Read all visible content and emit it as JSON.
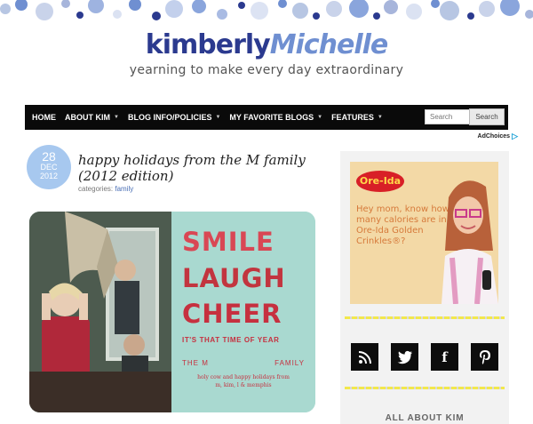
{
  "header": {
    "logo_first": "kimberly",
    "logo_last": "Michelle",
    "tagline": "yearning to make every day extraordinary"
  },
  "nav": {
    "items": [
      {
        "label": "HOME",
        "dropdown": false
      },
      {
        "label": "ABOUT KIM",
        "dropdown": true
      },
      {
        "label": "BLOG INFO/POLICIES",
        "dropdown": true
      },
      {
        "label": "MY FAVORITE BLOGS",
        "dropdown": true
      },
      {
        "label": "FEATURES",
        "dropdown": true
      }
    ],
    "search_placeholder": "Search",
    "search_button": "Search"
  },
  "adchoices": "AdChoices",
  "post": {
    "date_day": "28",
    "date_month": "DEC",
    "date_year": "2012",
    "title": "happy holidays from the M family (2012 edition)",
    "categories_label": "categories:",
    "category": "family",
    "card": {
      "word1": "SMILE",
      "word2": "LAUGH",
      "word3": "CHEER",
      "tagline": "IT'S THAT TIME OF YEAR",
      "family_left": "THE M",
      "family_right": "FAMILY",
      "message_line1": "holy cow and happy holidays from",
      "message_line2": "m, kim, l     & memphis"
    }
  },
  "sidebar": {
    "ad": {
      "brand": "Ore-Ida",
      "text": "Hey mom, know how many calories are in Ore-Ida Golden Crinkles®?"
    },
    "social": [
      "rss-icon",
      "twitter-icon",
      "facebook-icon",
      "pinterest-icon"
    ],
    "about_heading": "ALL ABOUT KIM"
  },
  "colors": {
    "nav_bg": "#0a0a0a",
    "accent_blue": "#2b3a8f",
    "date_badge": "#a7c8ef",
    "card_red": "#c6303f",
    "card_mint": "#a9d9d0",
    "stripe_yellow": "#f2e84b"
  }
}
